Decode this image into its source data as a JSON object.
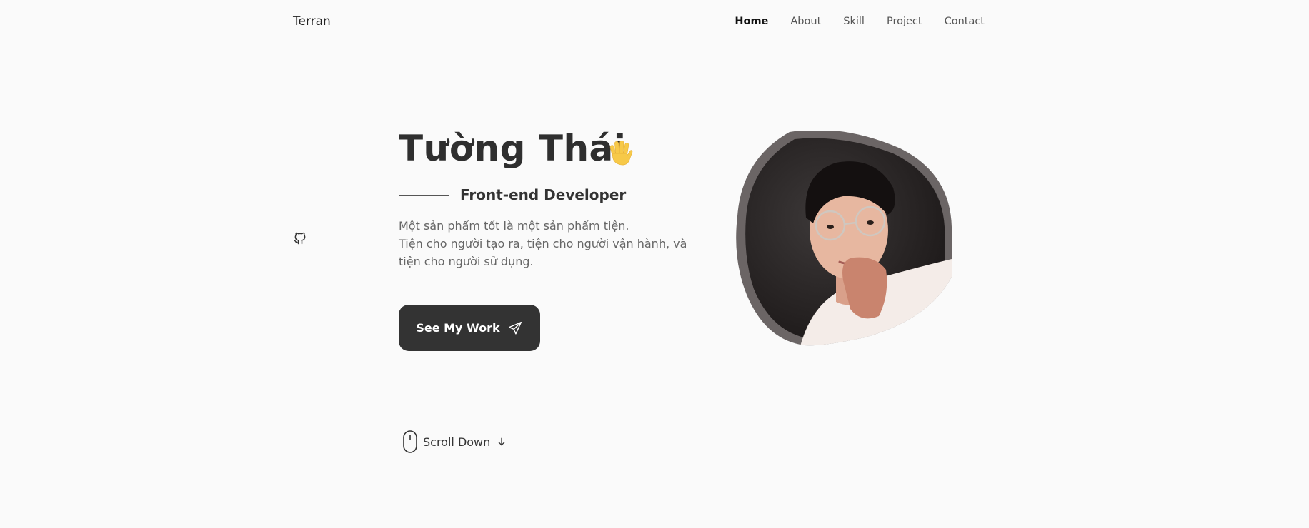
{
  "header": {
    "logo": "Terran",
    "nav": [
      {
        "label": "Home",
        "active": true
      },
      {
        "label": "About",
        "active": false
      },
      {
        "label": "Skill",
        "active": false
      },
      {
        "label": "Project",
        "active": false
      },
      {
        "label": "Contact",
        "active": false
      }
    ]
  },
  "social": {
    "icon": "github-icon"
  },
  "hero": {
    "name": "Tường Thái",
    "wave_icon": "waving-hand-icon",
    "subtitle": "Front-end Developer",
    "description": [
      "Một sản phẩm tốt là một sản phẩm tiện.",
      "Tiện cho người tạo ra, tiện cho người vận hành, và tiện cho người sử dụng."
    ],
    "cta_label": "See My Work",
    "cta_icon": "send-icon",
    "portrait_icon": "profile-photo"
  },
  "scroll": {
    "label": "Scroll Down",
    "mouse_icon": "mouse-icon",
    "arrow_icon": "arrow-down-icon"
  },
  "colors": {
    "background": "#fafafa",
    "text": "#333333",
    "button": "#333333",
    "blob_border": "#6b6565",
    "wave": "#f7c948"
  }
}
